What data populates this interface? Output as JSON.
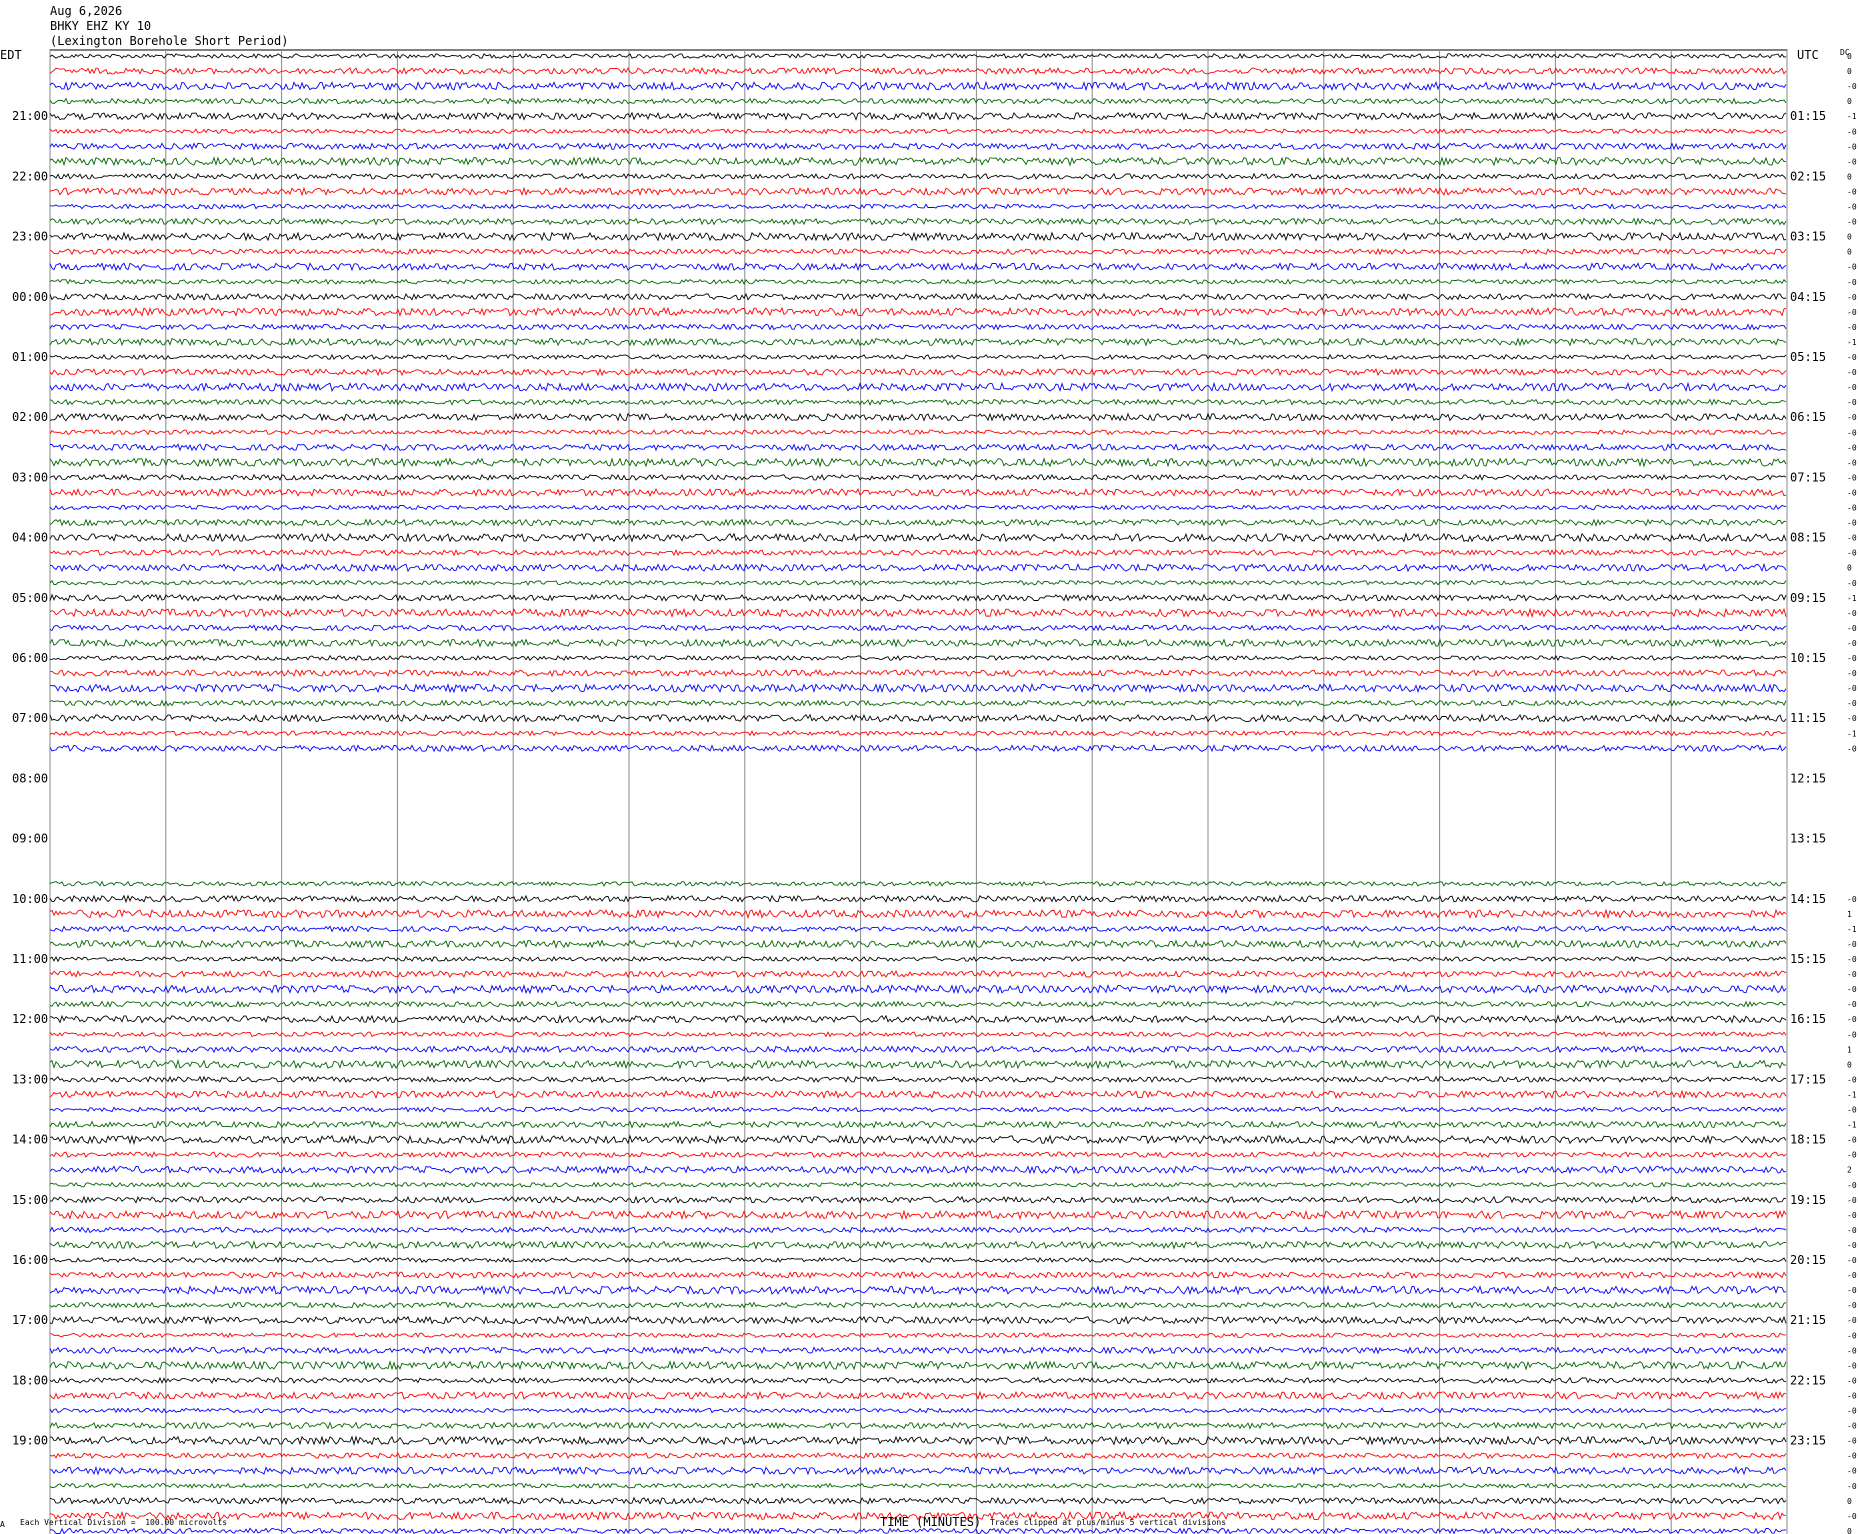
{
  "header": {
    "date": "Aug 6,2026",
    "station": "BHKY EHZ KY 10",
    "site": "(Lexington Borehole Short Period)"
  },
  "left_zone_label": "EDT",
  "right_zone_label": "UTC",
  "dc_label": "DC",
  "footer": {
    "scale_note": "Each Vertical Division =  100.00 microvolts",
    "xlabel": "TIME (MINUTES)",
    "clip_note": "Traces clipped at plus/minus 5 vertical divisions",
    "corner_mark": "A"
  },
  "trace_colors": [
    "#000000",
    "#ff0000",
    "#0000ff",
    "#006400"
  ],
  "chart_data": {
    "type": "line",
    "title": "BHKY EHZ KY 10 (Lexington Borehole Short Period)",
    "xlabel": "TIME (MINUTES)",
    "xlim": [
      0,
      15
    ],
    "x_ticks": [
      "00",
      "01",
      "02",
      "03",
      "04",
      "05",
      "06",
      "07",
      "08",
      "09",
      "10",
      "11",
      "12",
      "13",
      "14",
      "15"
    ],
    "rows_per_hour": 4,
    "hour_labels_edt": [
      "21:00",
      "22:00",
      "23:00",
      "00:00",
      "01:00",
      "02:00",
      "03:00",
      "04:00",
      "05:00",
      "06:00",
      "07:00",
      "08:00",
      "09:00",
      "10:00",
      "11:00",
      "12:00",
      "13:00",
      "14:00",
      "15:00",
      "16:00",
      "17:00",
      "18:00",
      "19:00"
    ],
    "hour_labels_utc": [
      "01:15",
      "02:15",
      "03:15",
      "04:15",
      "05:15",
      "06:15",
      "07:15",
      "08:15",
      "09:15",
      "10:15",
      "11:15",
      "12:15",
      "13:15",
      "14:15",
      "15:15",
      "16:15",
      "17:15",
      "18:15",
      "19:15",
      "20:15",
      "21:15",
      "22:15",
      "23:15"
    ],
    "first_row_offset": -4,
    "gap_rows_from": 47,
    "gap_rows_to": 54,
    "dc_offsets": [
      "0",
      "0",
      "-0",
      "0",
      "-1",
      "-0",
      "-0",
      "-0",
      "0",
      "-0",
      "-0",
      "-0",
      "0",
      "0",
      "-0",
      "-0",
      "-0",
      "-0",
      "-0",
      "-1",
      "-0",
      "-0",
      "-0",
      "-0",
      "-0",
      "-0",
      "-0",
      "-0",
      "-0",
      "-0",
      "-0",
      "-0",
      "-0",
      "-0",
      "0",
      "-0",
      "-1",
      "-0",
      "-0",
      "-0",
      "-0",
      "-0",
      "-0",
      "-0",
      "-0",
      "-1",
      "-0",
      "1",
      "-0",
      "",
      "",
      "",
      "",
      "",
      "",
      "",
      "-0",
      "1",
      "-1",
      "-0",
      "-0",
      "-0",
      "-0",
      "-0",
      "-0",
      "-0",
      "1",
      "0",
      "-0",
      "-1",
      "-0",
      "-1",
      "-0",
      "-0",
      "2",
      "-0",
      "-0",
      "-0",
      "-0",
      "-0",
      "-0",
      "-0",
      "-0",
      "-0",
      "-0",
      "-0",
      "-0",
      "-0",
      "-0",
      "-0",
      "-0",
      "-0",
      "-0",
      "-0",
      "-0",
      "-0",
      "0",
      "-0",
      "0"
    ],
    "clip_note": "Traces clipped at plus/minus 5 vertical divisions",
    "scale": "Each Vertical Division = 100.00 microvolts"
  }
}
